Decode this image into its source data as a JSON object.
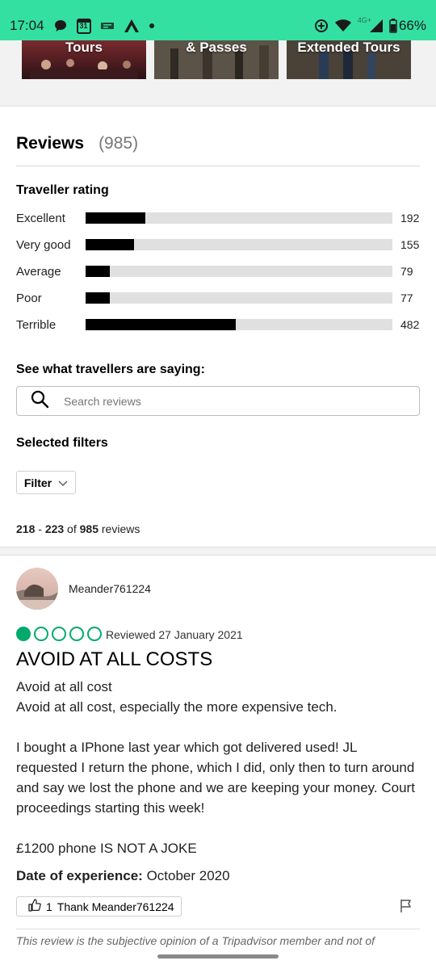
{
  "status_bar": {
    "time": "17:04",
    "calendar_day": "31",
    "network_label": "4G+",
    "battery": "66%"
  },
  "cards": [
    {
      "label": "Tours"
    },
    {
      "label": "& Passes"
    },
    {
      "label": "Extended Tours"
    }
  ],
  "reviews": {
    "title": "Reviews",
    "count": "(985)"
  },
  "traveller_rating": {
    "title": "Traveller rating",
    "rows": [
      {
        "label": "Excellent",
        "count": "192",
        "fraction": 0.195
      },
      {
        "label": "Very good",
        "count": "155",
        "fraction": 0.157
      },
      {
        "label": "Average",
        "count": "79",
        "fraction": 0.08
      },
      {
        "label": "Poor",
        "count": "77",
        "fraction": 0.078
      },
      {
        "label": "Terrible",
        "count": "482",
        "fraction": 0.49
      }
    ]
  },
  "search": {
    "title": "See what travellers are saying:",
    "placeholder": "Search reviews"
  },
  "filters": {
    "title": "Selected filters",
    "filter_label": "Filter"
  },
  "range": {
    "start": "218",
    "dash": " - ",
    "end": "223",
    "of": " of ",
    "total": "985",
    "suffix": " reviews"
  },
  "review": {
    "username": "Meander761224",
    "rating_bubbles": 1,
    "date": "Reviewed 27 January 2021",
    "title": "AVOID AT ALL COSTS",
    "body_line1": "Avoid at all cost",
    "body_line2": "Avoid at all cost, especially the more expensive tech.",
    "body_para2": "I bought a IPhone last year which got delivered used! JL requested I return the phone, which I did, only then to turn around and say we lost the phone and we are keeping your money. Court proceedings starting this week!",
    "body_para3": "£1200 phone IS NOT A JOKE",
    "experience_label": "Date of experience:",
    "experience_value": " October 2020",
    "thank_count": "1",
    "thank_label": "Thank Meander761224",
    "disclaimer": "This review is the subjective opinion of a Tripadvisor member and not of"
  },
  "colors": {
    "status_bar": "#34e0a1",
    "bubble_green": "#00aa6c"
  }
}
